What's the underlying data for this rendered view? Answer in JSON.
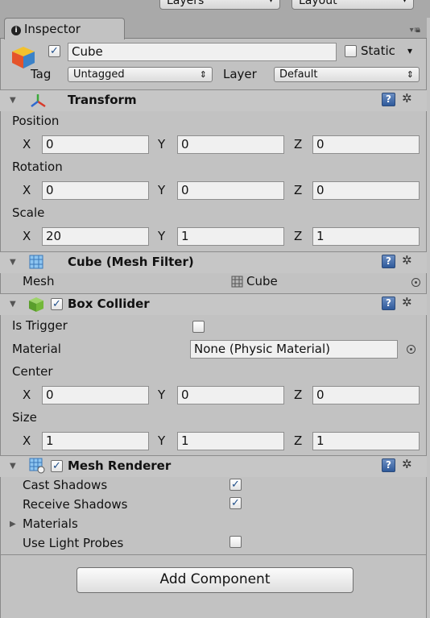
{
  "top": {
    "layers_label": "Layers",
    "layout_label": "Layout"
  },
  "tab": {
    "label": "Inspector"
  },
  "object": {
    "name": "Cube",
    "active": "✓",
    "static_label": "Static",
    "tag_label": "Tag",
    "tag_value": "Untagged",
    "layer_label": "Layer",
    "layer_value": "Default"
  },
  "transform": {
    "title": "Transform",
    "position_label": "Position",
    "rotation_label": "Rotation",
    "scale_label": "Scale",
    "position": {
      "x": "0",
      "y": "0",
      "z": "0"
    },
    "rotation": {
      "x": "0",
      "y": "0",
      "z": "0"
    },
    "scale": {
      "x": "20",
      "y": "1",
      "z": "1"
    }
  },
  "axis": {
    "x": "X",
    "y": "Y",
    "z": "Z"
  },
  "mesh_filter": {
    "title": "Cube (Mesh Filter)",
    "mesh_label": "Mesh",
    "mesh_value": "Cube"
  },
  "box_collider": {
    "title": "Box Collider",
    "enabled": "✓",
    "is_trigger_label": "Is Trigger",
    "material_label": "Material",
    "material_value": "None (Physic Material)",
    "center_label": "Center",
    "size_label": "Size",
    "center": {
      "x": "0",
      "y": "0",
      "z": "0"
    },
    "size": {
      "x": "1",
      "y": "1",
      "z": "1"
    }
  },
  "mesh_renderer": {
    "title": "Mesh Renderer",
    "enabled": "✓",
    "cast_shadows_label": "Cast Shadows",
    "cast_shadows": "✓",
    "receive_shadows_label": "Receive Shadows",
    "receive_shadows": "✓",
    "materials_label": "Materials",
    "use_light_probes_label": "Use Light Probes"
  },
  "glyphs": {
    "help": "?",
    "gear": "✲",
    "fold_open": "▼",
    "fold_closed": "▶",
    "dropdown": "▾",
    "updown": "⇕"
  },
  "add_component_label": "Add Component"
}
